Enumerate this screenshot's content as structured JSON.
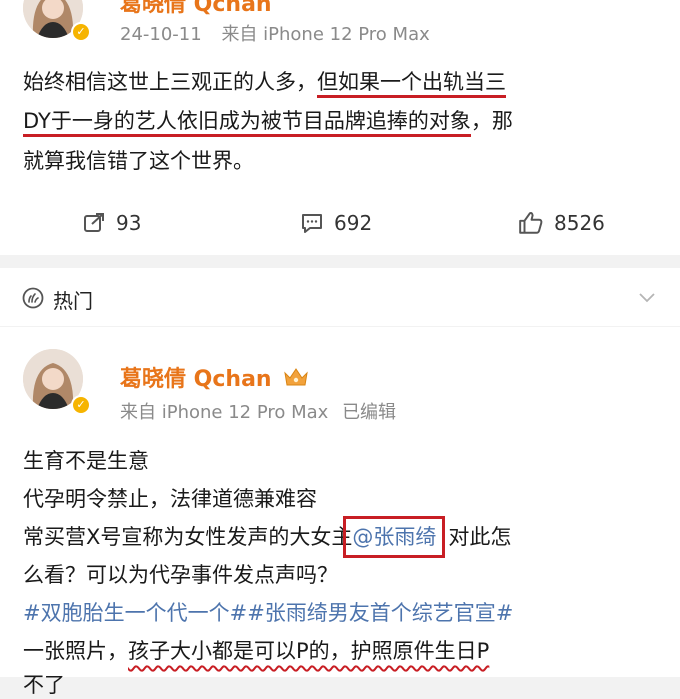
{
  "post1": {
    "username": "葛晓倩 Qchan",
    "date": "24-10-11",
    "source": "来自 iPhone 12 Pro Max",
    "text_lines": [
      "始终相信这世上三观正的人多，",
      "但如果一个出轨当三",
      "DY于一身的艺人依旧成为被节目品牌追捧的对象",
      "，那",
      "就算我信错了这个世界。"
    ],
    "repost_count": "93",
    "comment_count": "692",
    "like_count": "8526"
  },
  "hot": {
    "label": "热门"
  },
  "post2": {
    "username": "葛晓倩 Qchan",
    "source": "来自 iPhone 12 Pro Max",
    "edited": "已编辑",
    "line1": "生育不是生意",
    "line2": "代孕明令禁止，法律道德兼难容",
    "line3_pre": "常买营X号宣称为女性发声的大女主",
    "line3_mention": "@张雨绮",
    "line3_post": "对此怎",
    "line4": "么看？可以为代孕事件发点声吗？",
    "topic1": "#双胞胎生一个代一个#",
    "topic2": "#张雨绮男友首个综艺官宣#",
    "line6_pre": "一张照片，",
    "line6_wavy": "孩子大小都是可以P的，护照原件生日P",
    "line7_partial": "不了"
  },
  "colors": {
    "accent_red": "#c81e24",
    "link_blue": "#4d74ad",
    "name_orange": "#e8751a"
  },
  "icons": [
    "avatar",
    "verified-badge",
    "repost-icon",
    "comment-icon",
    "like-icon",
    "hot-icon",
    "chevron-down-icon",
    "crown-badge-icon"
  ]
}
